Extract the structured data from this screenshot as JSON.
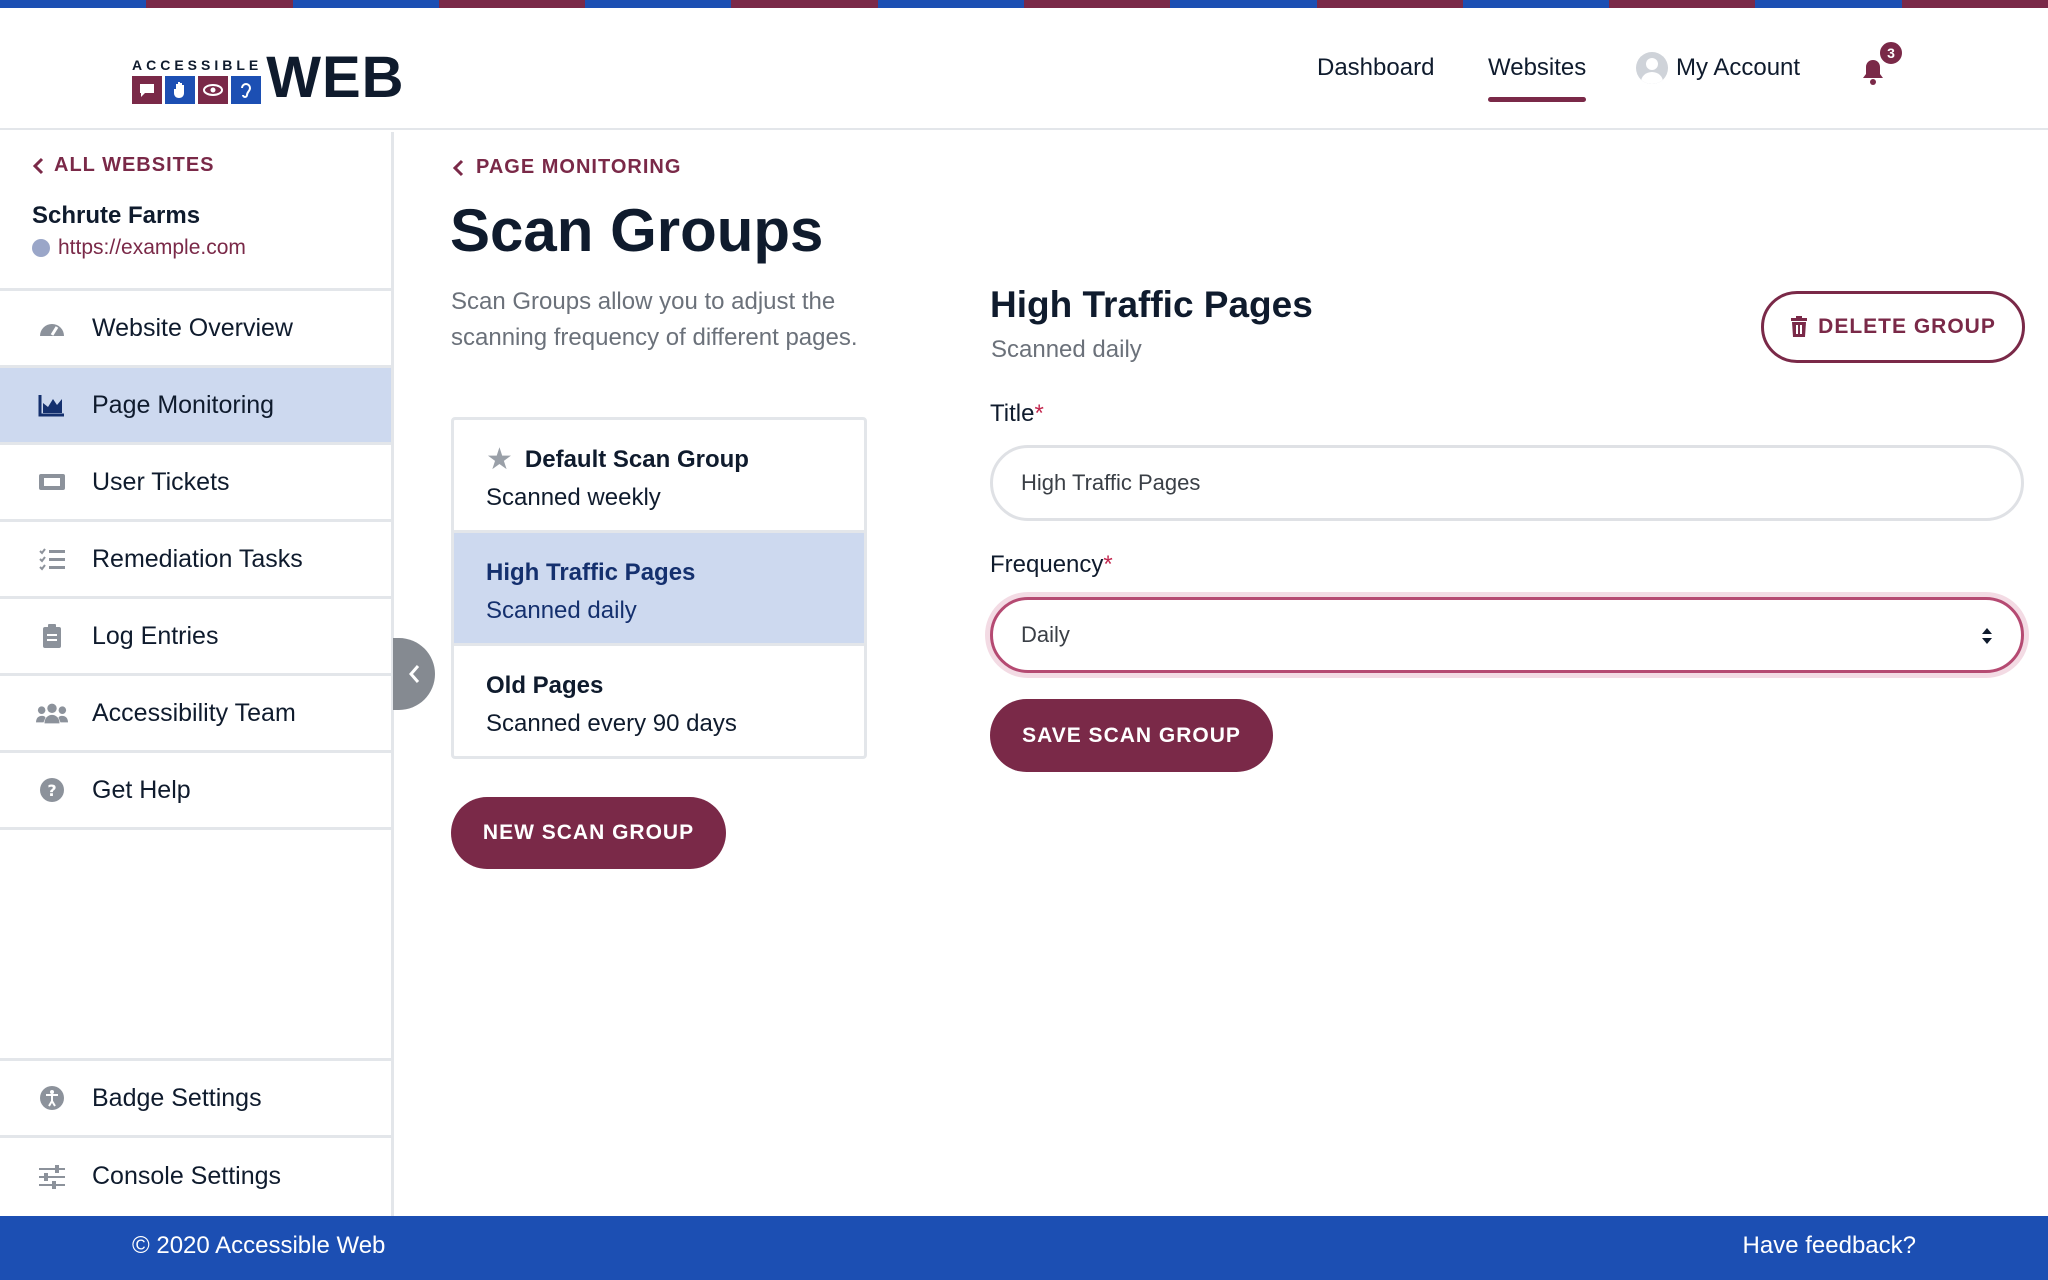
{
  "brand": {
    "logo_small": "ACCESSIBLE",
    "logo_large": "WEB"
  },
  "nav": {
    "dashboard": "Dashboard",
    "websites": "Websites",
    "account": "My Account",
    "notification_count": "3"
  },
  "sidebar": {
    "back_label": "ALL WEBSITES",
    "site_name": "Schrute Farms",
    "site_url": "https://example.com",
    "items": [
      {
        "label": "Website Overview",
        "icon": "gauge-icon"
      },
      {
        "label": "Page Monitoring",
        "icon": "area-chart-icon"
      },
      {
        "label": "User Tickets",
        "icon": "ticket-icon"
      },
      {
        "label": "Remediation Tasks",
        "icon": "checklist-icon"
      },
      {
        "label": "Log Entries",
        "icon": "clipboard-icon"
      },
      {
        "label": "Accessibility Team",
        "icon": "users-icon"
      },
      {
        "label": "Get Help",
        "icon": "question-icon"
      }
    ],
    "bottom_items": [
      {
        "label": "Badge Settings",
        "icon": "accessibility-icon"
      },
      {
        "label": "Console Settings",
        "icon": "sliders-icon"
      }
    ],
    "active_item": "Page Monitoring"
  },
  "main": {
    "breadcrumb": "PAGE MONITORING",
    "title": "Scan Groups",
    "description": "Scan Groups allow you to adjust the scanning frequency of different pages.",
    "groups": [
      {
        "title": "Default Scan Group",
        "subtitle": "Scanned weekly",
        "default": true
      },
      {
        "title": "High Traffic Pages",
        "subtitle": "Scanned daily",
        "selected": true
      },
      {
        "title": "Old Pages",
        "subtitle": "Scanned every 90 days"
      }
    ],
    "new_button": "NEW SCAN GROUP"
  },
  "form": {
    "title": "High Traffic Pages",
    "subtitle": "Scanned daily",
    "delete_button": "DELETE GROUP",
    "title_label": "Title",
    "title_value": "High Traffic Pages",
    "frequency_label": "Frequency",
    "frequency_value": "Daily",
    "required_marker": "*",
    "save_button": "SAVE SCAN GROUP"
  },
  "footer": {
    "copyright": "© 2020 Accessible Web",
    "feedback": "Have feedback?"
  },
  "colors": {
    "brand_red": "#7a2948",
    "brand_blue": "#1c4fb3",
    "active_bg": "#cdd9ef",
    "text_dark": "#0f1b2d"
  }
}
